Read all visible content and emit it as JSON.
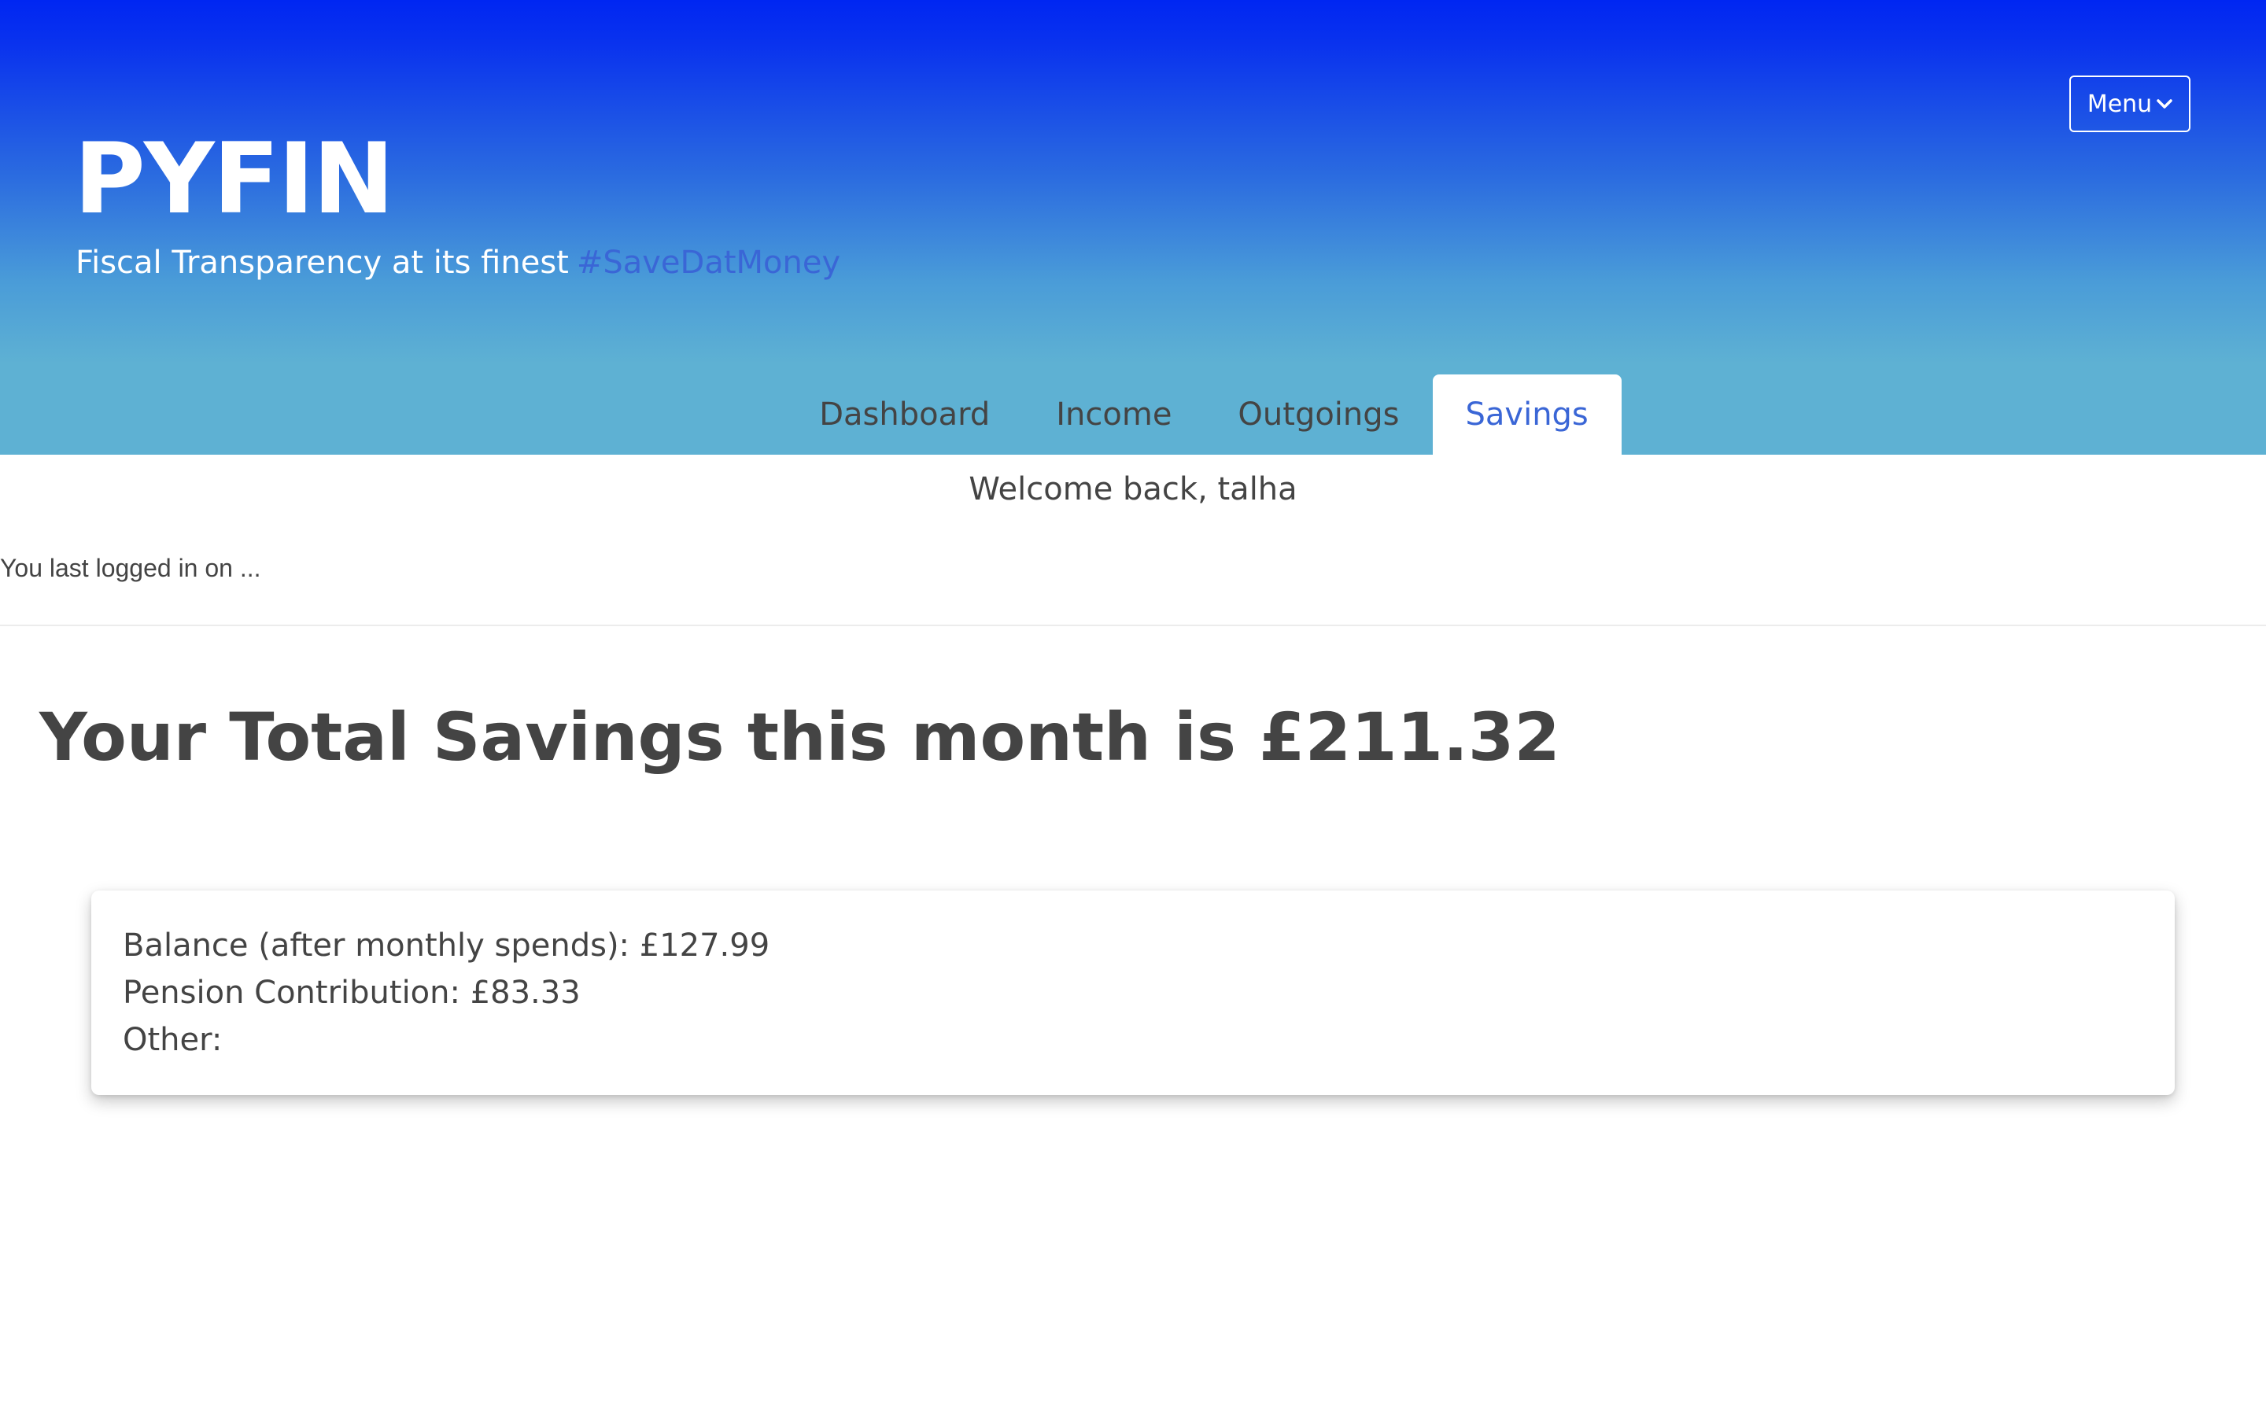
{
  "header": {
    "title": "PYFIN",
    "subtitle": "Fiscal Transparency at its finest",
    "hashtag": "#SaveDatMoney",
    "menu_label": "Menu"
  },
  "tabs": [
    {
      "label": "Dashboard",
      "active": false
    },
    {
      "label": "Income",
      "active": false
    },
    {
      "label": "Outgoings",
      "active": false
    },
    {
      "label": "Savings",
      "active": true
    }
  ],
  "welcome": "Welcome back, talha",
  "last_login": "You last logged in on ...",
  "total_savings": "Your Total Savings this month is £211.32",
  "savings_card": {
    "balance": "Balance (after monthly spends): £127.99",
    "pension": "Pension Contribution: £83.33",
    "other": "Other:"
  },
  "colors": {
    "gradient_top": "#0026f2",
    "gradient_bottom": "#5eb1d3",
    "accent": "#3a66d6",
    "text": "#444444"
  },
  "icons": {
    "menu_chevron": "chevron-down-icon"
  }
}
